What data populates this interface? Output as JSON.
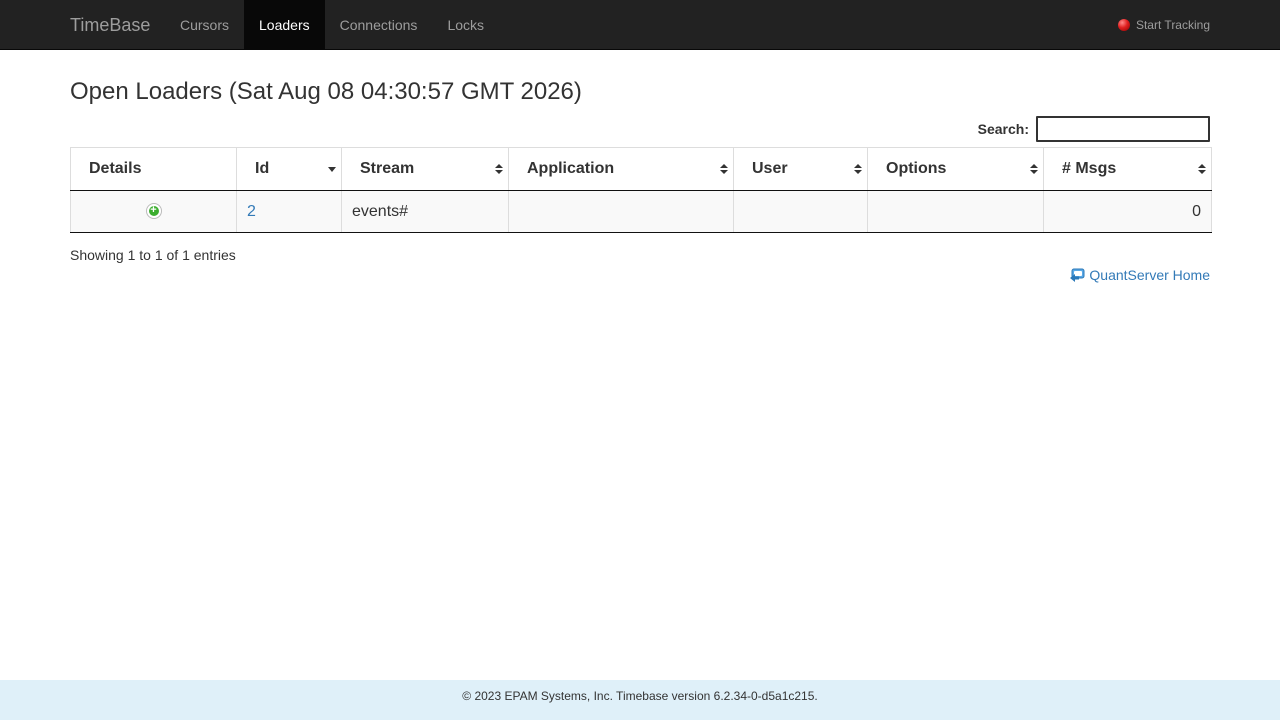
{
  "navbar": {
    "brand": "TimeBase",
    "items": [
      {
        "label": "Cursors",
        "active": false
      },
      {
        "label": "Loaders",
        "active": true
      },
      {
        "label": "Connections",
        "active": false
      },
      {
        "label": "Locks",
        "active": false
      }
    ],
    "tracking_label": "Start Tracking",
    "tracking_icon": "record-dot-icon"
  },
  "page": {
    "title": "Open Loaders (Sat Aug 08 04:30:57 GMT 2026)"
  },
  "search": {
    "label": "Search:",
    "value": ""
  },
  "table": {
    "columns": [
      "Details",
      "Id",
      "Stream",
      "Application",
      "User",
      "Options",
      "# Msgs"
    ],
    "rows": [
      {
        "id": "2",
        "stream": "events#",
        "application": "",
        "user": "",
        "options": "",
        "msgs": "0"
      }
    ]
  },
  "info": "Showing 1 to 1 of 1 entries",
  "home_link": "QuantServer Home",
  "footer": "© 2023 EPAM Systems, Inc. Timebase version 6.2.34-0-d5a1c215.",
  "colors": {
    "navbar_bg": "#222222",
    "nav_active_bg": "#080808",
    "link": "#337ab7",
    "footer_bg": "#dff0f9",
    "expand_green": "#3cae2f"
  }
}
